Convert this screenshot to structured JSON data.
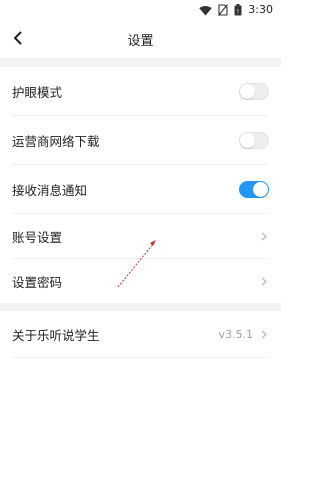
{
  "status_bar": {
    "time": "3:30",
    "icons": [
      "wifi-icon",
      "no-sim-icon",
      "battery-icon"
    ]
  },
  "header": {
    "title": "设置",
    "back_icon": "chevron-left-icon"
  },
  "settings": {
    "eye_mode": {
      "label": "护眼模式",
      "enabled": false
    },
    "carrier_download": {
      "label": "运营商网络下载",
      "enabled": false
    },
    "notifications": {
      "label": "接收消息通知",
      "enabled": true
    },
    "account": {
      "label": "账号设置"
    },
    "password": {
      "label": "设置密码"
    },
    "about": {
      "label": "关于乐听说学生",
      "version": "v3.5.1"
    }
  },
  "colors": {
    "accent": "#2196f3",
    "divider": "#eef0f2",
    "section_bg": "#f2f3f5",
    "annotation": "#c0392b"
  }
}
